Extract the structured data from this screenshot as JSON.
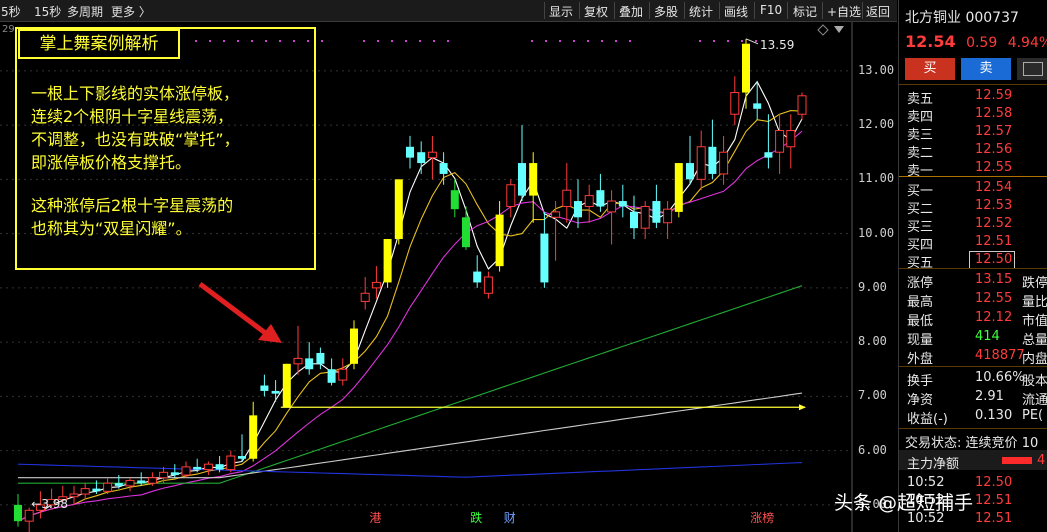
{
  "toolbar": {
    "left_items": [
      "5秒",
      "15秒",
      "多周期",
      "更多 〉"
    ],
    "right_items": [
      "显示",
      "复权",
      "叠加",
      "多股",
      "统计",
      "画线",
      "F10",
      "标记",
      "+自选",
      "返回"
    ]
  },
  "chart_top_left": "29",
  "chart_data": {
    "type": "candlestick",
    "ylim": [
      4.5,
      13.9
    ],
    "y_ticks": [
      5.0,
      6.0,
      7.0,
      8.0,
      9.0,
      10.0,
      11.0,
      12.0,
      13.0
    ],
    "high_label": "13.59",
    "low_label": "3.98",
    "support_line_price": 6.8,
    "candles": [
      {
        "o": 5.0,
        "h": 5.2,
        "l": 4.6,
        "c": 4.7
      },
      {
        "o": 4.7,
        "h": 4.95,
        "l": 4.25,
        "c": 4.9
      },
      {
        "o": 4.9,
        "h": 5.25,
        "l": 4.75,
        "c": 5.0
      },
      {
        "o": 5.0,
        "h": 5.3,
        "l": 4.95,
        "c": 5.1
      },
      {
        "o": 5.1,
        "h": 5.35,
        "l": 5.05,
        "c": 5.15
      },
      {
        "o": 5.15,
        "h": 5.35,
        "l": 5.0,
        "c": 5.2
      },
      {
        "o": 5.2,
        "h": 5.4,
        "l": 5.1,
        "c": 5.3
      },
      {
        "o": 5.3,
        "h": 5.45,
        "l": 5.2,
        "c": 5.25
      },
      {
        "o": 5.25,
        "h": 5.5,
        "l": 5.2,
        "c": 5.4
      },
      {
        "o": 5.4,
        "h": 5.55,
        "l": 5.3,
        "c": 5.35
      },
      {
        "o": 5.35,
        "h": 5.5,
        "l": 5.25,
        "c": 5.45
      },
      {
        "o": 5.45,
        "h": 5.6,
        "l": 5.35,
        "c": 5.4
      },
      {
        "o": 5.4,
        "h": 5.6,
        "l": 5.35,
        "c": 5.5
      },
      {
        "o": 5.5,
        "h": 5.7,
        "l": 5.4,
        "c": 5.6
      },
      {
        "o": 5.6,
        "h": 5.75,
        "l": 5.5,
        "c": 5.55
      },
      {
        "o": 5.55,
        "h": 5.8,
        "l": 5.5,
        "c": 5.7
      },
      {
        "o": 5.7,
        "h": 5.85,
        "l": 5.6,
        "c": 5.65
      },
      {
        "o": 5.65,
        "h": 5.8,
        "l": 5.55,
        "c": 5.75
      },
      {
        "o": 5.75,
        "h": 5.9,
        "l": 5.6,
        "c": 5.65
      },
      {
        "o": 5.65,
        "h": 6.0,
        "l": 5.6,
        "c": 5.9
      },
      {
        "o": 5.9,
        "h": 6.3,
        "l": 5.8,
        "c": 5.85
      },
      {
        "o": 5.85,
        "h": 6.9,
        "l": 5.8,
        "c": 6.65
      },
      {
        "o": 7.2,
        "h": 7.4,
        "l": 7.0,
        "c": 7.1
      },
      {
        "o": 7.1,
        "h": 7.3,
        "l": 6.9,
        "c": 7.05
      },
      {
        "o": 6.8,
        "h": 7.6,
        "l": 6.8,
        "c": 7.6
      },
      {
        "o": 7.6,
        "h": 8.3,
        "l": 7.4,
        "c": 7.7
      },
      {
        "o": 7.7,
        "h": 8.0,
        "l": 7.4,
        "c": 7.5
      },
      {
        "o": 7.8,
        "h": 7.9,
        "l": 7.5,
        "c": 7.6
      },
      {
        "o": 7.5,
        "h": 7.7,
        "l": 7.2,
        "c": 7.25
      },
      {
        "o": 7.3,
        "h": 7.7,
        "l": 7.2,
        "c": 7.5
      },
      {
        "o": 7.6,
        "h": 8.4,
        "l": 7.5,
        "c": 8.25
      },
      {
        "o": 8.75,
        "h": 9.2,
        "l": 8.6,
        "c": 8.9
      },
      {
        "o": 9.0,
        "h": 9.4,
        "l": 8.8,
        "c": 9.1
      },
      {
        "o": 9.1,
        "h": 9.9,
        "l": 9.0,
        "c": 9.9
      },
      {
        "o": 9.9,
        "h": 11.0,
        "l": 9.8,
        "c": 11.0
      },
      {
        "o": 11.6,
        "h": 11.8,
        "l": 11.2,
        "c": 11.4
      },
      {
        "o": 11.5,
        "h": 11.7,
        "l": 11.1,
        "c": 11.3
      },
      {
        "o": 11.4,
        "h": 11.8,
        "l": 11.0,
        "c": 11.5
      },
      {
        "o": 11.3,
        "h": 11.5,
        "l": 10.9,
        "c": 11.1
      },
      {
        "o": 10.8,
        "h": 11.0,
        "l": 10.3,
        "c": 10.45
      },
      {
        "o": 10.3,
        "h": 10.5,
        "l": 9.7,
        "c": 9.75
      },
      {
        "o": 9.3,
        "h": 9.6,
        "l": 9.0,
        "c": 9.1
      },
      {
        "o": 8.9,
        "h": 9.3,
        "l": 8.8,
        "c": 9.2
      },
      {
        "o": 9.4,
        "h": 10.6,
        "l": 9.3,
        "c": 10.35
      },
      {
        "o": 10.5,
        "h": 11.0,
        "l": 10.3,
        "c": 10.9
      },
      {
        "o": 11.3,
        "h": 12.0,
        "l": 10.6,
        "c": 10.7
      },
      {
        "o": 10.7,
        "h": 11.5,
        "l": 10.2,
        "c": 11.3
      },
      {
        "o": 10.0,
        "h": 10.4,
        "l": 9.0,
        "c": 9.1
      },
      {
        "o": 10.3,
        "h": 10.6,
        "l": 9.5,
        "c": 10.4
      },
      {
        "o": 10.5,
        "h": 11.3,
        "l": 10.2,
        "c": 10.8
      },
      {
        "o": 10.6,
        "h": 11.0,
        "l": 10.1,
        "c": 10.3
      },
      {
        "o": 10.5,
        "h": 10.9,
        "l": 10.2,
        "c": 10.7
      },
      {
        "o": 10.8,
        "h": 11.1,
        "l": 10.4,
        "c": 10.5
      },
      {
        "o": 10.4,
        "h": 10.8,
        "l": 9.8,
        "c": 10.6
      },
      {
        "o": 10.6,
        "h": 10.9,
        "l": 10.3,
        "c": 10.5
      },
      {
        "o": 10.4,
        "h": 10.7,
        "l": 9.9,
        "c": 10.1
      },
      {
        "o": 10.1,
        "h": 10.6,
        "l": 9.9,
        "c": 10.5
      },
      {
        "o": 10.6,
        "h": 10.9,
        "l": 10.1,
        "c": 10.2
      },
      {
        "o": 10.2,
        "h": 10.6,
        "l": 9.9,
        "c": 10.45
      },
      {
        "o": 10.4,
        "h": 11.3,
        "l": 10.3,
        "c": 11.3
      },
      {
        "o": 11.3,
        "h": 11.8,
        "l": 10.9,
        "c": 11.0
      },
      {
        "o": 11.0,
        "h": 11.9,
        "l": 10.8,
        "c": 11.6
      },
      {
        "o": 11.6,
        "h": 12.1,
        "l": 11.0,
        "c": 11.1
      },
      {
        "o": 11.1,
        "h": 11.8,
        "l": 10.9,
        "c": 11.5
      },
      {
        "o": 12.2,
        "h": 12.9,
        "l": 12.0,
        "c": 12.6
      },
      {
        "o": 12.6,
        "h": 13.59,
        "l": 12.3,
        "c": 13.5
      },
      {
        "o": 12.4,
        "h": 12.8,
        "l": 12.1,
        "c": 12.3
      },
      {
        "o": 11.5,
        "h": 12.2,
        "l": 11.2,
        "c": 11.4
      },
      {
        "o": 11.5,
        "h": 12.2,
        "l": 11.1,
        "c": 11.9
      },
      {
        "o": 11.6,
        "h": 12.2,
        "l": 11.2,
        "c": 11.9
      },
      {
        "o": 12.2,
        "h": 12.6,
        "l": 12.1,
        "c": 12.54
      }
    ],
    "green_body_indices": [
      0,
      39,
      40
    ],
    "bottom_labels": [
      {
        "text": "港",
        "index": 32,
        "color": "#ff5050"
      },
      {
        "text": "跌",
        "index": 41,
        "color": "#3cff3c"
      },
      {
        "text": "财",
        "index": 44,
        "color": "#6fa0ff"
      },
      {
        "text": "涨榜",
        "index": 66,
        "color": "#ff5050"
      }
    ]
  },
  "annotation": {
    "title": "掌上舞案例解析",
    "lines": [
      "一根上下影线的实体涨停板，",
      "连续2个根阴十字星线震荡，",
      "不调整，也没有跌破“掌托”，",
      "即涨停板价格支撑托。",
      "",
      "这种涨停后2根十字星震荡的",
      "也称其为“双星闪耀”。"
    ]
  },
  "panel": {
    "name": "北方铜业",
    "code": "000737",
    "price": "12.54",
    "change": "0.59",
    "change_pct": "4.94%",
    "buy_btn": "买",
    "sell_btn": "卖",
    "sell_levels": [
      {
        "label": "卖五",
        "price": "12.59"
      },
      {
        "label": "卖四",
        "price": "12.58"
      },
      {
        "label": "卖三",
        "price": "12.57"
      },
      {
        "label": "卖二",
        "price": "12.56"
      },
      {
        "label": "卖一",
        "price": "12.55"
      }
    ],
    "buy_levels": [
      {
        "label": "买一",
        "price": "12.54"
      },
      {
        "label": "买二",
        "price": "12.53"
      },
      {
        "label": "买三",
        "price": "12.52"
      },
      {
        "label": "买四",
        "price": "12.51"
      },
      {
        "label": "买五",
        "price": "12.50"
      }
    ],
    "stats": [
      {
        "label": "涨停",
        "value": "13.15",
        "right": "跌停"
      },
      {
        "label": "最高",
        "value": "12.55",
        "right": "量比"
      },
      {
        "label": "最低",
        "value": "12.12",
        "right": "市值"
      },
      {
        "label": "现量",
        "value": "414",
        "right": "总量"
      },
      {
        "label": "外盘",
        "value": "418877",
        "right": "内盘"
      }
    ],
    "stats2": [
      {
        "label": "换手",
        "value": "10.66%",
        "right": "股本"
      },
      {
        "label": "净资",
        "value": "2.91",
        "right": "流通"
      },
      {
        "label": "收益(-)",
        "value": "0.130",
        "right": "PE("
      }
    ],
    "trade_status_label": "交易状态:",
    "trade_status_value": "连续竞价",
    "trade_status_extra": "10",
    "main_flow_label": "主力净额",
    "main_flow_value": "4",
    "ticks": [
      {
        "time": "10:52",
        "price": "12.50"
      },
      {
        "time": "10:52",
        "price": "12.51"
      },
      {
        "time": "10:52",
        "price": "12.51"
      }
    ]
  },
  "watermark": "头条 @超短捕手",
  "colors": {
    "up_red": "#ff3b3b",
    "up_yellow": "#ffff00",
    "down_cyan": "#66ffff",
    "green": "#22dd33",
    "annotation": "#ffff33"
  }
}
